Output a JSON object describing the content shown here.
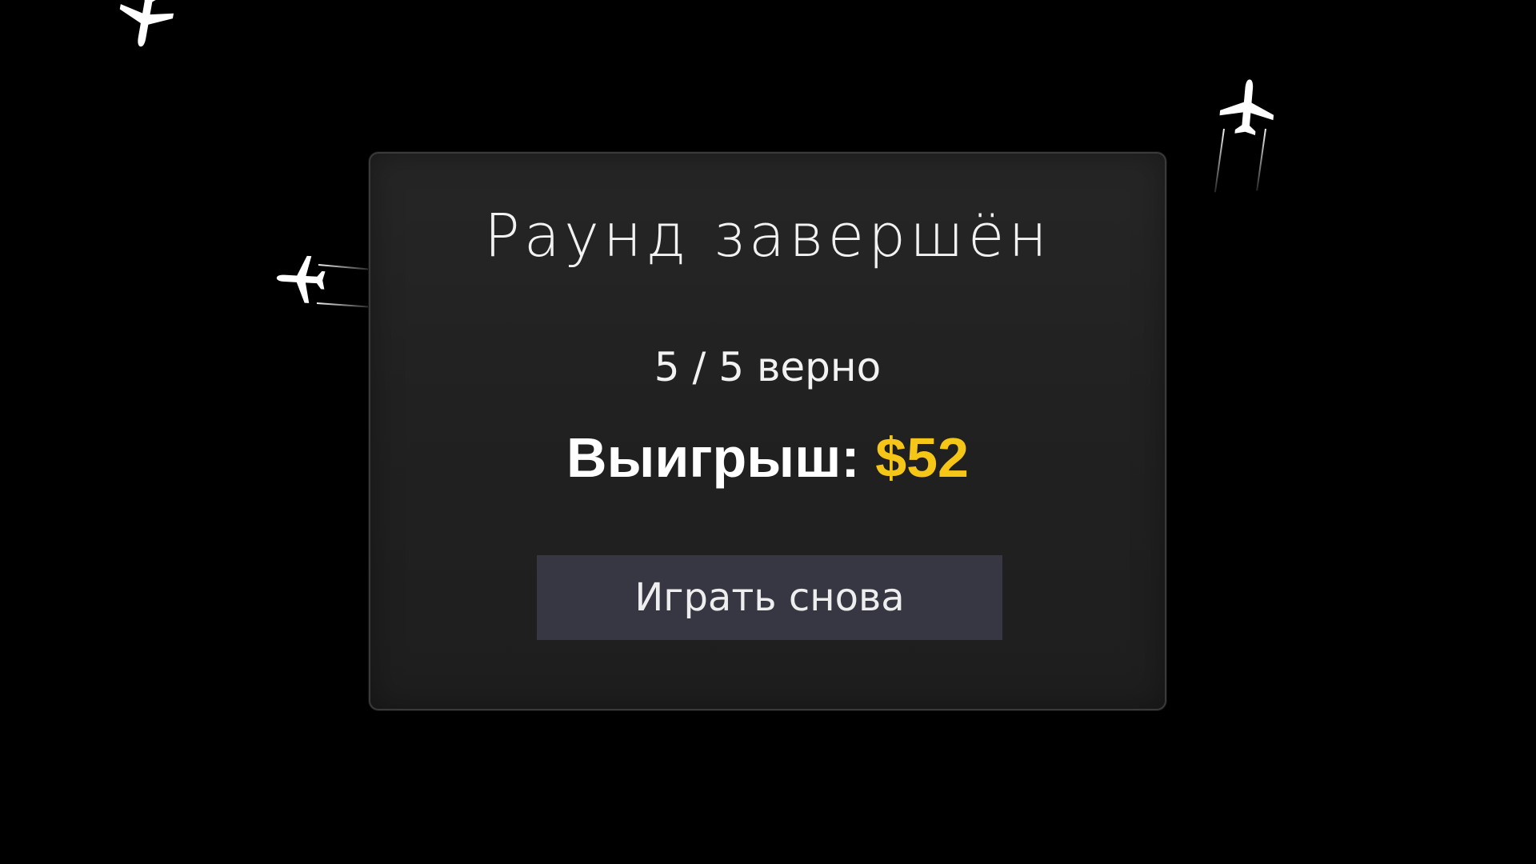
{
  "dialog": {
    "title": "Раунд завершён",
    "score_text": "5 / 5 верно",
    "winnings_label": "Выигрыш:",
    "winnings_amount": "$52",
    "play_again_label": "Играть снова"
  },
  "colors": {
    "background": "#000000",
    "panel": "#222222",
    "button": "#373744",
    "accent": "#f5c518",
    "text": "#f2f2f2"
  },
  "decor": {
    "plane_icon": "airplane-icon"
  }
}
